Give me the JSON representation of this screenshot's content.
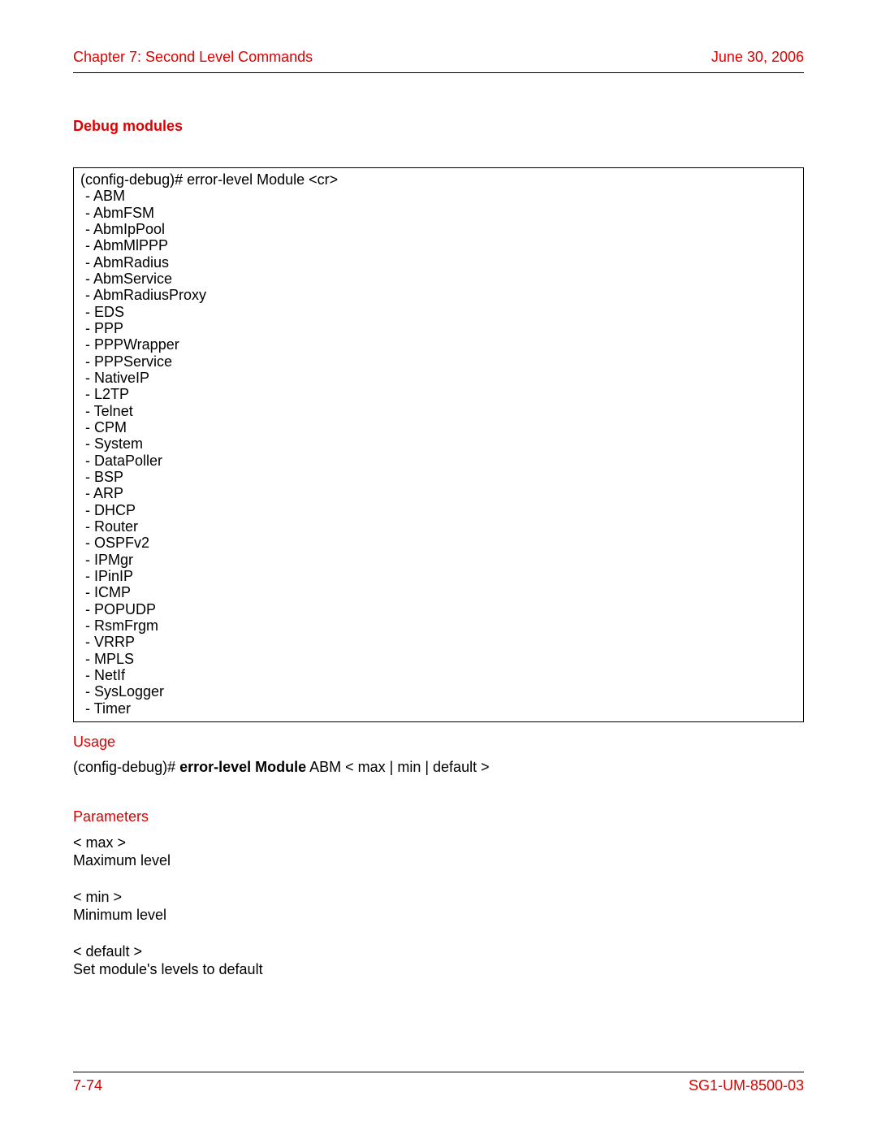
{
  "header": {
    "chapter": "Chapter 7: Second Level Commands",
    "date": "June 30, 2006"
  },
  "section": {
    "title": "Debug modules"
  },
  "box": {
    "command": "(config-debug)# error-level Module <cr>",
    "modules": [
      "ABM",
      "AbmFSM",
      "AbmIpPool",
      "AbmMlPPP",
      "AbmRadius",
      "AbmService",
      "AbmRadiusProxy",
      "EDS",
      "PPP",
      "PPPWrapper",
      "PPPService",
      "NativeIP",
      "L2TP",
      "Telnet",
      "CPM",
      "System",
      "DataPoller",
      "BSP",
      "ARP",
      "DHCP",
      "Router",
      "OSPFv2",
      "IPMgr",
      "IPinIP",
      "ICMP",
      "POPUDP",
      "RsmFrgm",
      "VRRP",
      "MPLS",
      "NetIf",
      "SysLogger",
      "Timer"
    ]
  },
  "usage": {
    "heading": "Usage",
    "prefix": "(config-debug)# ",
    "bold": "error-level Module",
    "suffix": " ABM < max | min | default >"
  },
  "parameters": {
    "heading": "Parameters",
    "items": [
      {
        "name": " < max >",
        "desc": "Maximum level"
      },
      {
        "name": " < min >",
        "desc": " Minimum level"
      },
      {
        "name": "< default >",
        "desc": "Set module's levels to default"
      }
    ]
  },
  "footer": {
    "page": "7-74",
    "doc": "SG1-UM-8500-03"
  }
}
